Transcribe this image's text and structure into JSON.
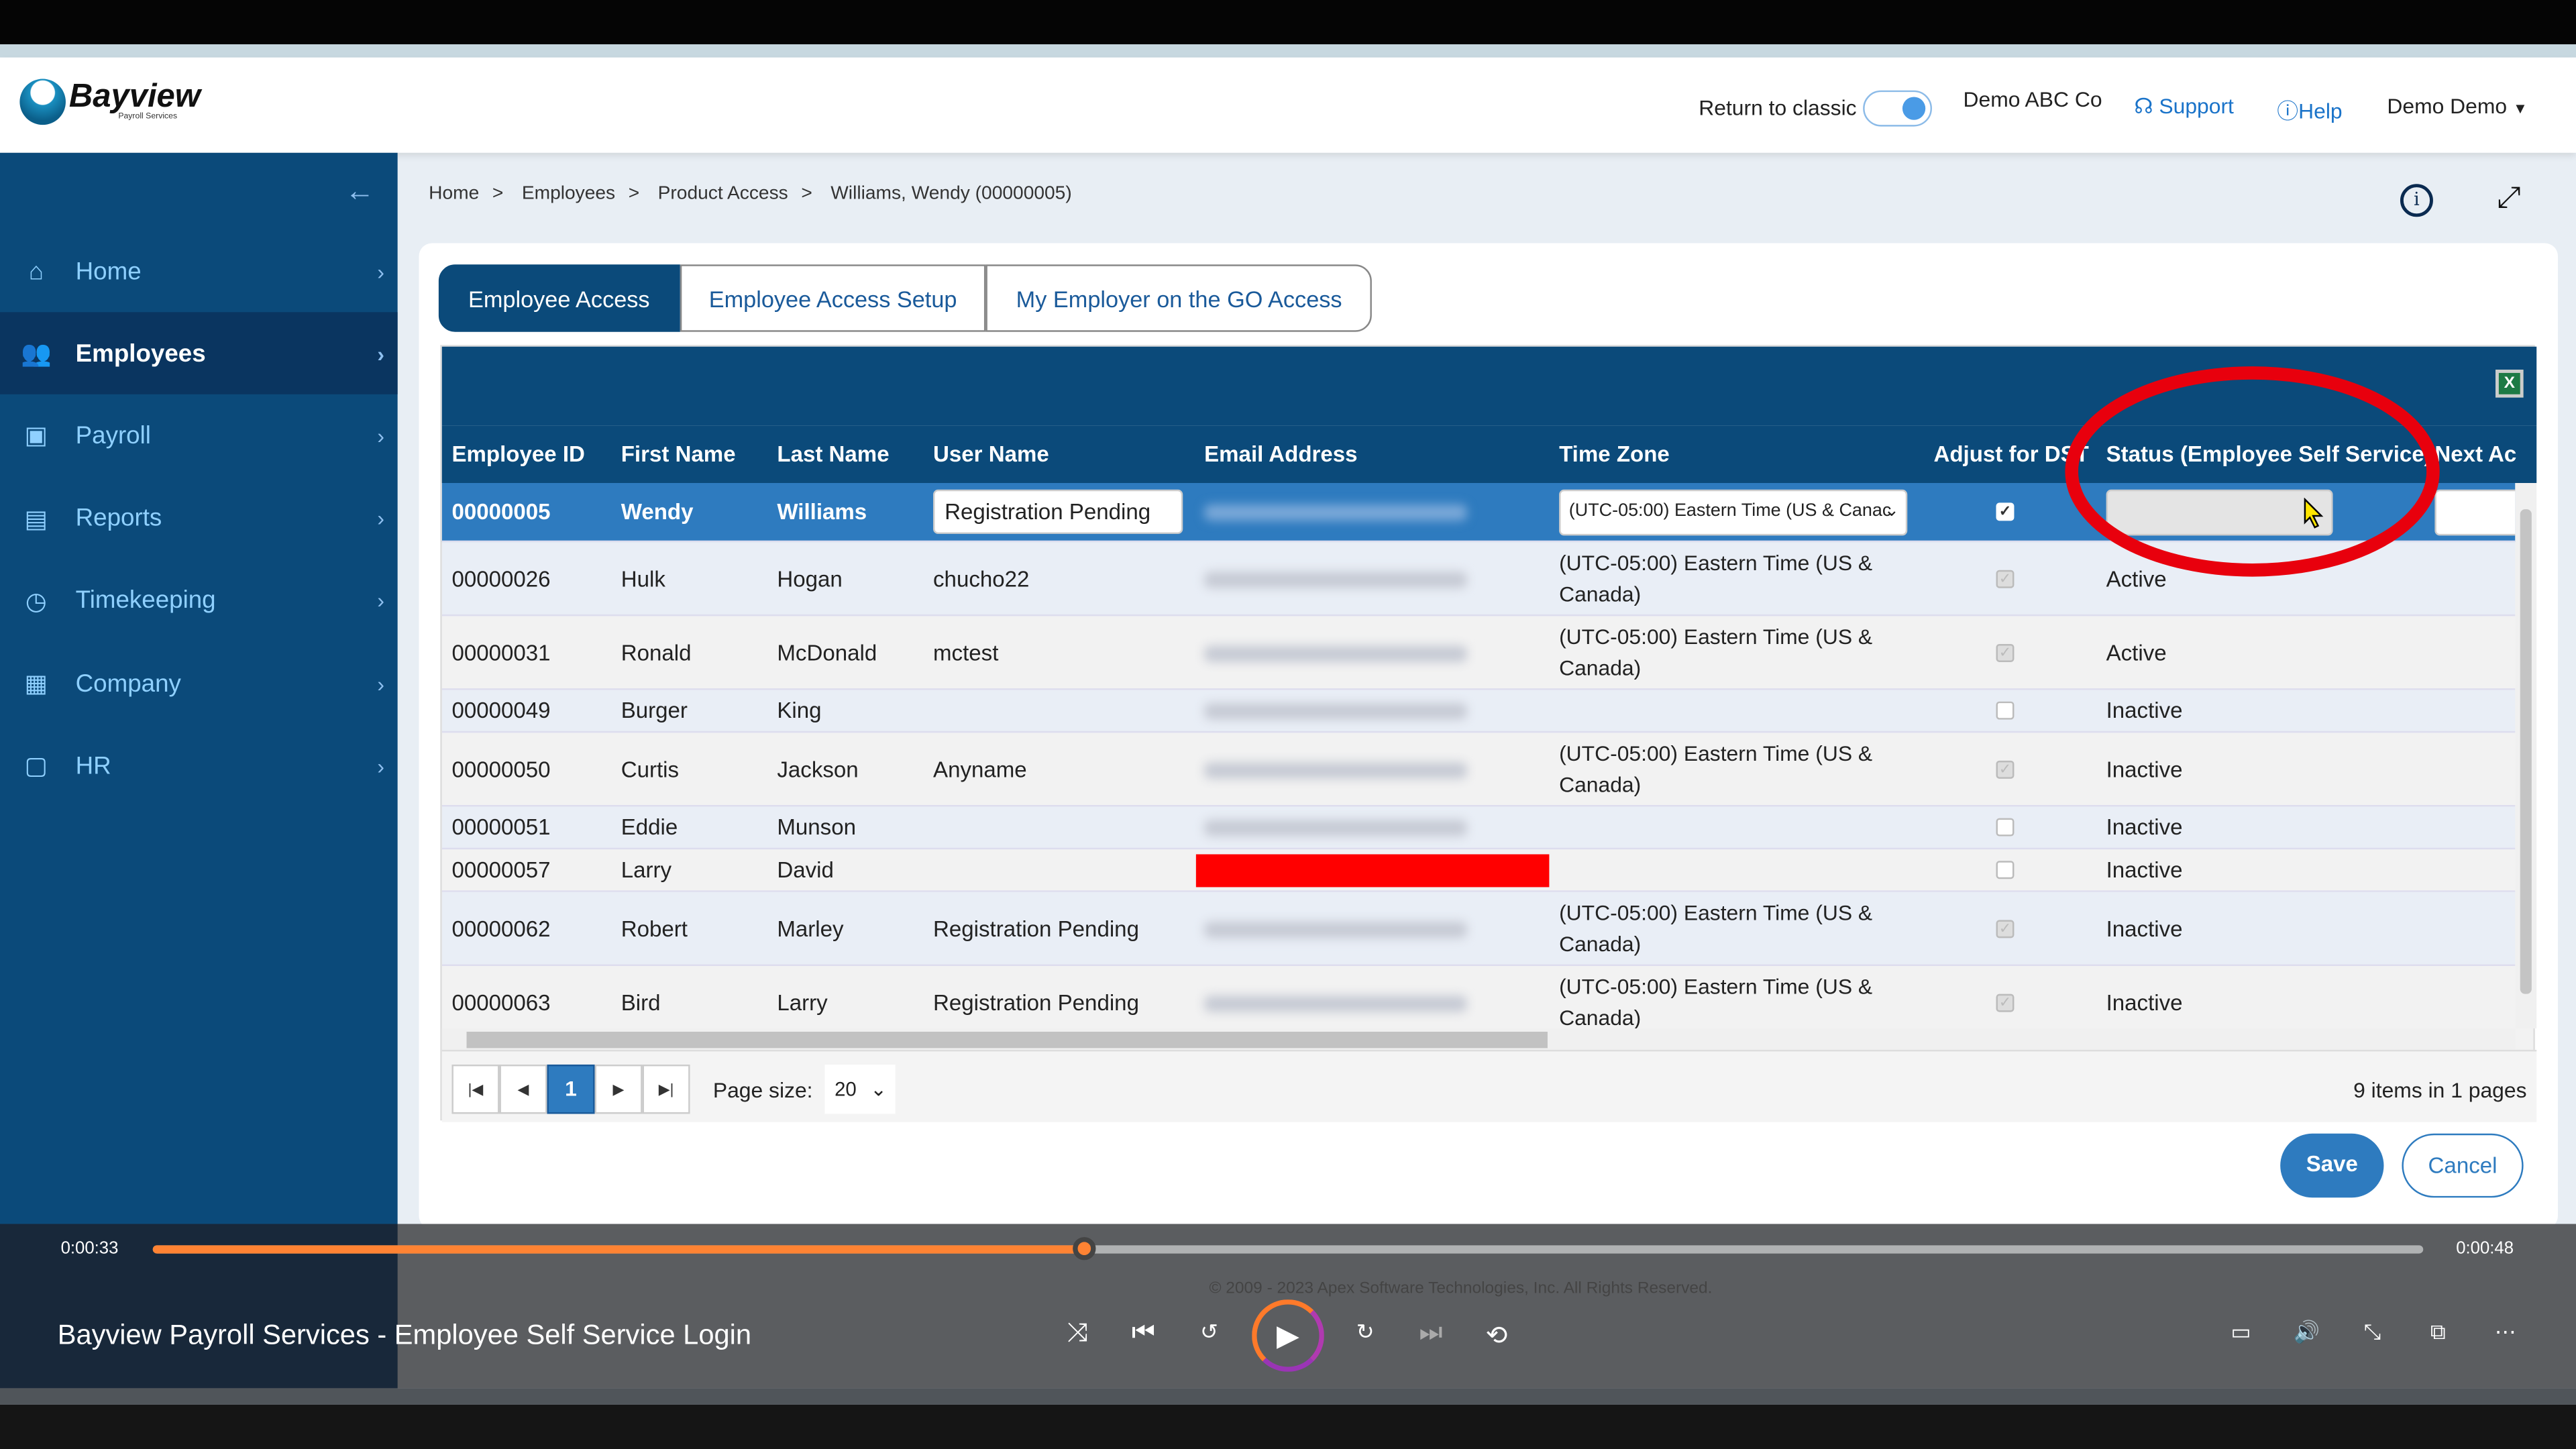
{
  "header": {
    "logo_text": "Bayview",
    "logo_sub": "Payroll Services",
    "return_classic_label": "Return to classic",
    "return_classic_on": true,
    "company": "Demo ABC Co",
    "support": "Support",
    "help": "Help",
    "user": "Demo Demo"
  },
  "sidebar": {
    "items": [
      {
        "label": "Home",
        "icon": "home-icon",
        "glyph": "⌂"
      },
      {
        "label": "Employees",
        "icon": "users-icon",
        "glyph": "👥"
      },
      {
        "label": "Payroll",
        "icon": "payroll-icon",
        "glyph": "▣"
      },
      {
        "label": "Reports",
        "icon": "clipboard-icon",
        "glyph": "▤"
      },
      {
        "label": "Timekeeping",
        "icon": "clock-icon",
        "glyph": "◷"
      },
      {
        "label": "Company",
        "icon": "building-icon",
        "glyph": "▦"
      },
      {
        "label": "HR",
        "icon": "id-card-icon",
        "glyph": "▢"
      }
    ],
    "active": "Employees"
  },
  "breadcrumb": [
    "Home",
    "Employees",
    "Product Access",
    "Williams, Wendy (00000005)"
  ],
  "tabs": [
    "Employee Access",
    "Employee Access Setup",
    "My Employer on the GO Access"
  ],
  "grid": {
    "columns": [
      "Employee ID",
      "First Name",
      "Last Name",
      "User Name",
      "Email Address",
      "Time Zone",
      "Adjust for DST",
      "Status (Employee Self Service)",
      "Next Ac"
    ],
    "rows": [
      {
        "id": "00000005",
        "first": "Wendy",
        "last": "Williams",
        "user": "Registration Pending",
        "tz": "(UTC-05:00) Eastern Time (US & Canac",
        "dst": true,
        "status": ""
      },
      {
        "id": "00000026",
        "first": "Hulk",
        "last": "Hogan",
        "user": "chucho22",
        "tz": "(UTC-05:00) Eastern Time (US & Canada)",
        "dst": true,
        "status": "Active"
      },
      {
        "id": "00000031",
        "first": "Ronald",
        "last": "McDonald",
        "user": "mctest",
        "tz": "(UTC-05:00) Eastern Time (US & Canada)",
        "dst": true,
        "status": "Active"
      },
      {
        "id": "00000049",
        "first": "Burger",
        "last": "King",
        "user": "",
        "tz": "",
        "dst": false,
        "status": "Inactive"
      },
      {
        "id": "00000050",
        "first": "Curtis",
        "last": "Jackson",
        "user": "Anyname",
        "tz": "(UTC-05:00) Eastern Time (US & Canada)",
        "dst": true,
        "status": "Inactive"
      },
      {
        "id": "00000051",
        "first": "Eddie",
        "last": "Munson",
        "user": "",
        "tz": "",
        "dst": false,
        "status": "Inactive"
      },
      {
        "id": "00000057",
        "first": "Larry",
        "last": "David",
        "user": "",
        "tz": "",
        "dst": false,
        "status": "Inactive"
      },
      {
        "id": "00000062",
        "first": "Robert",
        "last": "Marley",
        "user": "Registration Pending",
        "tz": "(UTC-05:00) Eastern Time (US & Canada)",
        "dst": true,
        "status": "Inactive"
      },
      {
        "id": "00000063",
        "first": "Bird",
        "last": "Larry",
        "user": "Registration Pending",
        "tz": "(UTC-05:00) Eastern Time (US & Canada)",
        "dst": true,
        "status": "Inactive"
      }
    ]
  },
  "pager": {
    "current_page": "1",
    "page_size_label": "Page size:",
    "page_size": "20",
    "summary": "9 items in 1 pages"
  },
  "actions": {
    "save": "Save",
    "cancel": "Cancel"
  },
  "player": {
    "elapsed": "0:00:33",
    "total": "0:00:48",
    "progress_percent": 41,
    "title": "Bayview Payroll Services - Employee Self Service Login",
    "copyright": "© 2009 - 2023 Apex Software Technologies, Inc. All Rights Reserved."
  },
  "colors": {
    "brand": "#0b4a7a",
    "selected_row": "#2e7bbf",
    "annotation": "#e8000d",
    "progress": "#ff8333"
  }
}
